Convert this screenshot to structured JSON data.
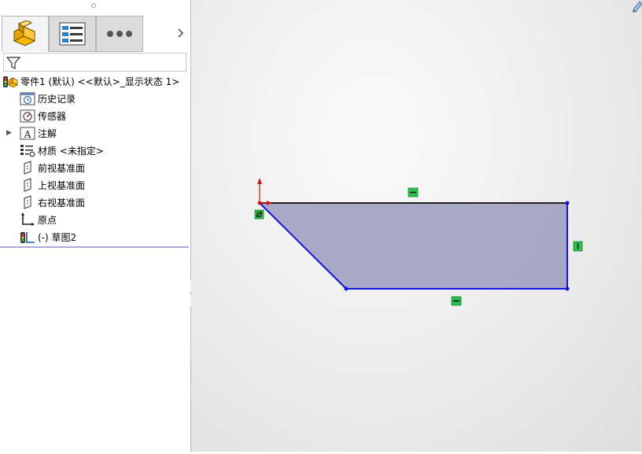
{
  "feature_manager": {
    "tabs": [
      {
        "name": "feature-manager-tab",
        "icon": "part-icon"
      },
      {
        "name": "property-manager-tab",
        "icon": "property-list-icon"
      },
      {
        "name": "more-tabs",
        "icon": "ellipsis-icon"
      }
    ],
    "tree": {
      "root": "零件1 (默认) <<默认>_显示状态 1>",
      "items": [
        {
          "label": "历史记录",
          "icon": "history-icon"
        },
        {
          "label": "传感器",
          "icon": "sensor-icon"
        },
        {
          "label": "注解",
          "icon": "annotation-icon"
        },
        {
          "label": "材质 <未指定>",
          "icon": "material-icon"
        },
        {
          "label": "前视基准面",
          "icon": "plane-icon"
        },
        {
          "label": "上视基准面",
          "icon": "plane-icon"
        },
        {
          "label": "右视基准面",
          "icon": "plane-icon"
        },
        {
          "label": "原点",
          "icon": "origin-icon"
        },
        {
          "label": "(-) 草图2",
          "icon": "sketch-icon"
        }
      ]
    }
  },
  "sketch": {
    "relations": [
      "horizontal-relation-icon",
      "vertical-relation-icon",
      "horizontal-relation-icon",
      "coincident-relation-icon"
    ],
    "colors": {
      "line": "#1414e0",
      "fill": "#a3a3c4",
      "relation_badge": "#2bc24a",
      "origin": "#d01818"
    }
  }
}
